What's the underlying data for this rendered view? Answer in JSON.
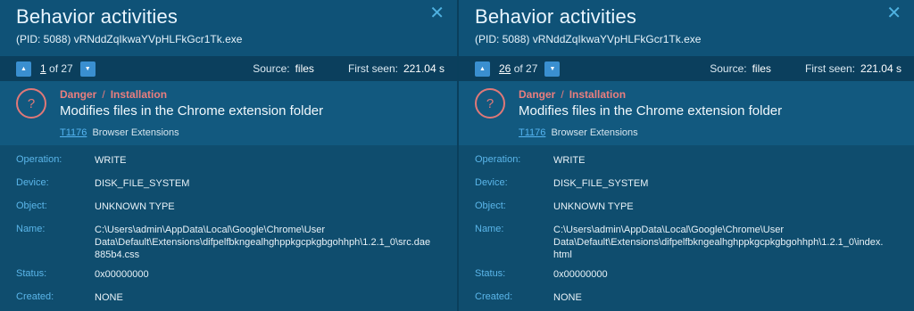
{
  "panels": [
    {
      "title": "Behavior activities",
      "process": "(PID: 5088) vRNddZqIkwaYVpHLFkGcr1Tk.exe",
      "close_icon": "close-icon",
      "pager": {
        "current": "1",
        "of": "of 27"
      },
      "source_label": "Source:",
      "source_value": "files",
      "first_seen_label": "First seen:",
      "first_seen_value": "221.04 s",
      "severity": "Danger",
      "separator": "/",
      "category": "Installation",
      "headline": "Modifies files in the Chrome extension folder",
      "technique_id": "T1176",
      "technique_name": "Browser Extensions",
      "details": {
        "operation_label": "Operation:",
        "operation": "WRITE",
        "device_label": "Device:",
        "device": "DISK_FILE_SYSTEM",
        "object_label": "Object:",
        "object": "UNKNOWN TYPE",
        "name_label": "Name:",
        "name_line1": "C:\\Users\\admin\\AppData\\Local\\Google\\Chrome\\User",
        "name_line2": "Data\\Default\\Extensions\\difpelfbkngealhghppkgcpkgbgohhph\\1.2.1_0\\src.dae",
        "name_line3": "885b4.css",
        "status_label": "Status:",
        "status": "0x00000000",
        "created_label": "Created:",
        "created": "NONE"
      }
    },
    {
      "title": "Behavior activities",
      "process": "(PID: 5088) vRNddZqIkwaYVpHLFkGcr1Tk.exe",
      "close_icon": "close-icon",
      "pager": {
        "current": "26",
        "of": "of 27"
      },
      "source_label": "Source:",
      "source_value": "files",
      "first_seen_label": "First seen:",
      "first_seen_value": "221.04 s",
      "severity": "Danger",
      "separator": "/",
      "category": "Installation",
      "headline": "Modifies files in the Chrome extension folder",
      "technique_id": "T1176",
      "technique_name": "Browser Extensions",
      "details": {
        "operation_label": "Operation:",
        "operation": "WRITE",
        "device_label": "Device:",
        "device": "DISK_FILE_SYSTEM",
        "object_label": "Object:",
        "object": "UNKNOWN TYPE",
        "name_label": "Name:",
        "name_line1": "C:\\Users\\admin\\AppData\\Local\\Google\\Chrome\\User",
        "name_line2": "Data\\Default\\Extensions\\difpelfbkngealhghppkgcpkgbgohhph\\1.2.1_0\\index.",
        "name_line3": "html",
        "status_label": "Status:",
        "status": "0x00000000",
        "created_label": "Created:",
        "created": "NONE"
      }
    }
  ],
  "colors": {
    "accent": "#3a8fd0",
    "danger": "#ea7e7e",
    "link": "#55b5f2",
    "label": "#5bb6ea"
  }
}
